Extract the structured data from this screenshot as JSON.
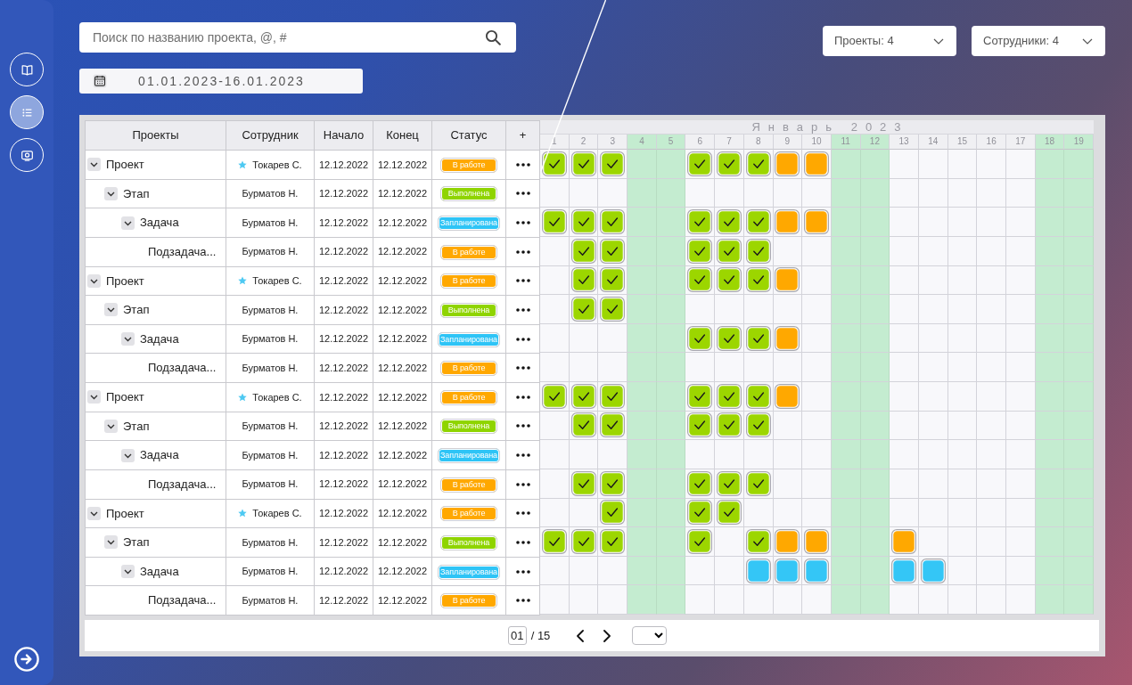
{
  "sidebar": {
    "items": [
      {
        "selected": false
      },
      {
        "selected": true
      },
      {
        "selected": false
      }
    ]
  },
  "search": {
    "placeholder": "Поиск по названию проекта, @, #"
  },
  "date_range": {
    "value": "01.01.2023-16.01.2023"
  },
  "filters": [
    {
      "label": "Проекты: 4"
    },
    {
      "label": "Сотрудники: 4"
    }
  ],
  "table": {
    "columns": [
      "Проекты",
      "Сотрудник",
      "Начало",
      "Конец",
      "Статус",
      "+"
    ],
    "rows": [
      {
        "name": "Проект",
        "expanded": true,
        "starred": true,
        "employee": "Токарев С.",
        "start": "12.12.2022",
        "end": "12.12.2022",
        "status": {
          "label": "В работе",
          "color": "#ffa800"
        },
        "timeline": [
          {
            "kind": "done"
          },
          {
            "kind": "done"
          },
          {
            "kind": "done"
          },
          {
            "kind": "empty"
          },
          {
            "kind": "empty"
          },
          {
            "kind": "done"
          },
          {
            "kind": "done"
          },
          {
            "kind": "done"
          },
          {
            "kind": "in_progress"
          },
          {
            "kind": "in_progress"
          },
          {
            "kind": "empty"
          },
          {
            "kind": "empty"
          },
          {
            "kind": "empty"
          },
          {
            "kind": "empty"
          },
          {
            "kind": "empty"
          },
          {
            "kind": "empty"
          },
          {
            "kind": "empty"
          },
          {
            "kind": "empty"
          },
          {
            "kind": "empty"
          }
        ],
        "children": [
          {
            "name": "Этап",
            "expanded": true,
            "starred": false,
            "employee": "Бурматов Н.",
            "start": "12.12.2022",
            "end": "12.12.2022",
            "status": {
              "label": "Выполнена",
              "color": "#8fd400"
            },
            "timeline": [
              {
                "kind": "empty"
              },
              {
                "kind": "empty"
              },
              {
                "kind": "empty"
              },
              {
                "kind": "empty"
              },
              {
                "kind": "empty"
              },
              {
                "kind": "empty"
              },
              {
                "kind": "empty"
              },
              {
                "kind": "empty"
              },
              {
                "kind": "empty"
              },
              {
                "kind": "empty"
              },
              {
                "kind": "empty"
              },
              {
                "kind": "empty"
              },
              {
                "kind": "empty"
              },
              {
                "kind": "empty"
              },
              {
                "kind": "empty"
              },
              {
                "kind": "empty"
              },
              {
                "kind": "empty"
              },
              {
                "kind": "empty"
              },
              {
                "kind": "empty"
              }
            ],
            "children": [
              {
                "name": "Задача",
                "expanded": true,
                "starred": false,
                "employee": "Бурматов Н.",
                "start": "12.12.2022",
                "end": "12.12.2022",
                "status": {
                  "label": "Запланирована",
                  "color": "#2ec4f6"
                },
                "timeline": [
                  {
                    "kind": "done"
                  },
                  {
                    "kind": "done"
                  },
                  {
                    "kind": "done"
                  },
                  {
                    "kind": "empty"
                  },
                  {
                    "kind": "empty"
                  },
                  {
                    "kind": "done"
                  },
                  {
                    "kind": "done"
                  },
                  {
                    "kind": "done"
                  },
                  {
                    "kind": "in_progress"
                  },
                  {
                    "kind": "in_progress"
                  },
                  {
                    "kind": "empty"
                  },
                  {
                    "kind": "empty"
                  },
                  {
                    "kind": "empty"
                  },
                  {
                    "kind": "empty"
                  },
                  {
                    "kind": "empty"
                  },
                  {
                    "kind": "empty"
                  },
                  {
                    "kind": "empty"
                  },
                  {
                    "kind": "empty"
                  },
                  {
                    "kind": "empty"
                  }
                ],
                "children": [
                  {
                    "name": "Подзадача...",
                    "starred": false,
                    "employee": "Бурматов Н.",
                    "start": "12.12.2022",
                    "end": "12.12.2022",
                    "status": {
                      "label": "В работе",
                      "color": "#ffa800"
                    },
                    "timeline": [
                      {
                        "kind": "empty"
                      },
                      {
                        "kind": "done"
                      },
                      {
                        "kind": "done"
                      },
                      {
                        "kind": "empty"
                      },
                      {
                        "kind": "empty"
                      },
                      {
                        "kind": "done"
                      },
                      {
                        "kind": "done"
                      },
                      {
                        "kind": "done"
                      },
                      {
                        "kind": "empty"
                      },
                      {
                        "kind": "empty"
                      },
                      {
                        "kind": "empty"
                      },
                      {
                        "kind": "empty"
                      },
                      {
                        "kind": "empty"
                      },
                      {
                        "kind": "empty"
                      },
                      {
                        "kind": "empty"
                      },
                      {
                        "kind": "empty"
                      },
                      {
                        "kind": "empty"
                      },
                      {
                        "kind": "empty"
                      },
                      {
                        "kind": "empty"
                      }
                    ]
                  }
                ]
              }
            ]
          }
        ]
      },
      {
        "name": "Проект",
        "expanded": true,
        "starred": true,
        "employee": "Токарев С.",
        "start": "12.12.2022",
        "end": "12.12.2022",
        "status": {
          "label": "В работе",
          "color": "#ffa800"
        },
        "timeline": [
          {
            "kind": "empty"
          },
          {
            "kind": "done"
          },
          {
            "kind": "done"
          },
          {
            "kind": "empty"
          },
          {
            "kind": "empty"
          },
          {
            "kind": "done"
          },
          {
            "kind": "done"
          },
          {
            "kind": "done"
          },
          {
            "kind": "in_progress"
          },
          {
            "kind": "empty"
          },
          {
            "kind": "empty"
          },
          {
            "kind": "empty"
          },
          {
            "kind": "empty"
          },
          {
            "kind": "empty"
          },
          {
            "kind": "empty"
          },
          {
            "kind": "empty"
          },
          {
            "kind": "empty"
          },
          {
            "kind": "empty"
          },
          {
            "kind": "empty"
          }
        ],
        "children": [
          {
            "name": "Этап",
            "expanded": true,
            "starred": false,
            "employee": "Бурматов Н.",
            "start": "12.12.2022",
            "end": "12.12.2022",
            "status": {
              "label": "Выполнена",
              "color": "#8fd400"
            },
            "timeline": [
              {
                "kind": "empty"
              },
              {
                "kind": "done"
              },
              {
                "kind": "done"
              },
              {
                "kind": "empty"
              },
              {
                "kind": "empty"
              },
              {
                "kind": "empty"
              },
              {
                "kind": "empty"
              },
              {
                "kind": "empty"
              },
              {
                "kind": "empty"
              },
              {
                "kind": "empty"
              },
              {
                "kind": "empty"
              },
              {
                "kind": "empty"
              },
              {
                "kind": "empty"
              },
              {
                "kind": "empty"
              },
              {
                "kind": "empty"
              },
              {
                "kind": "empty"
              },
              {
                "kind": "empty"
              },
              {
                "kind": "empty"
              },
              {
                "kind": "empty"
              }
            ],
            "children": [
              {
                "name": "Задача",
                "expanded": true,
                "starred": false,
                "employee": "Бурматов Н.",
                "start": "12.12.2022",
                "end": "12.12.2022",
                "status": {
                  "label": "Запланирована",
                  "color": "#2ec4f6"
                },
                "timeline": [
                  {
                    "kind": "empty"
                  },
                  {
                    "kind": "empty"
                  },
                  {
                    "kind": "empty"
                  },
                  {
                    "kind": "empty"
                  },
                  {
                    "kind": "empty"
                  },
                  {
                    "kind": "done"
                  },
                  {
                    "kind": "done"
                  },
                  {
                    "kind": "done"
                  },
                  {
                    "kind": "in_progress"
                  },
                  {
                    "kind": "empty"
                  },
                  {
                    "kind": "empty"
                  },
                  {
                    "kind": "empty"
                  },
                  {
                    "kind": "empty"
                  },
                  {
                    "kind": "empty"
                  },
                  {
                    "kind": "empty"
                  },
                  {
                    "kind": "empty"
                  },
                  {
                    "kind": "empty"
                  },
                  {
                    "kind": "empty"
                  },
                  {
                    "kind": "empty"
                  }
                ],
                "children": [
                  {
                    "name": "Подзадача...",
                    "starred": false,
                    "employee": "Бурматов Н.",
                    "start": "12.12.2022",
                    "end": "12.12.2022",
                    "status": {
                      "label": "В работе",
                      "color": "#ffa800"
                    },
                    "timeline": [
                      {
                        "kind": "empty"
                      },
                      {
                        "kind": "empty"
                      },
                      {
                        "kind": "empty"
                      },
                      {
                        "kind": "empty"
                      },
                      {
                        "kind": "empty"
                      },
                      {
                        "kind": "empty"
                      },
                      {
                        "kind": "empty"
                      },
                      {
                        "kind": "empty"
                      },
                      {
                        "kind": "empty"
                      },
                      {
                        "kind": "empty"
                      },
                      {
                        "kind": "empty"
                      },
                      {
                        "kind": "empty"
                      },
                      {
                        "kind": "empty"
                      },
                      {
                        "kind": "empty"
                      },
                      {
                        "kind": "empty"
                      },
                      {
                        "kind": "empty"
                      },
                      {
                        "kind": "empty"
                      },
                      {
                        "kind": "empty"
                      },
                      {
                        "kind": "empty"
                      }
                    ]
                  }
                ]
              }
            ]
          }
        ]
      },
      {
        "name": "Проект",
        "expanded": true,
        "starred": true,
        "employee": "Токарев С.",
        "start": "12.12.2022",
        "end": "12.12.2022",
        "status": {
          "label": "В работе",
          "color": "#ffa800"
        },
        "timeline": [
          {
            "kind": "done"
          },
          {
            "kind": "done"
          },
          {
            "kind": "done"
          },
          {
            "kind": "empty"
          },
          {
            "kind": "empty"
          },
          {
            "kind": "done"
          },
          {
            "kind": "done"
          },
          {
            "kind": "done"
          },
          {
            "kind": "in_progress"
          },
          {
            "kind": "empty"
          },
          {
            "kind": "empty"
          },
          {
            "kind": "empty"
          },
          {
            "kind": "empty"
          },
          {
            "kind": "empty"
          },
          {
            "kind": "empty"
          },
          {
            "kind": "empty"
          },
          {
            "kind": "empty"
          },
          {
            "kind": "empty"
          },
          {
            "kind": "empty"
          }
        ],
        "children": [
          {
            "name": "Этап",
            "expanded": true,
            "starred": false,
            "employee": "Бурматов Н.",
            "start": "12.12.2022",
            "end": "12.12.2022",
            "status": {
              "label": "Выполнена",
              "color": "#8fd400"
            },
            "timeline": [
              {
                "kind": "empty"
              },
              {
                "kind": "done"
              },
              {
                "kind": "done"
              },
              {
                "kind": "empty"
              },
              {
                "kind": "empty"
              },
              {
                "kind": "done"
              },
              {
                "kind": "done"
              },
              {
                "kind": "done"
              },
              {
                "kind": "empty"
              },
              {
                "kind": "empty"
              },
              {
                "kind": "empty"
              },
              {
                "kind": "empty"
              },
              {
                "kind": "empty"
              },
              {
                "kind": "empty"
              },
              {
                "kind": "empty"
              },
              {
                "kind": "empty"
              },
              {
                "kind": "empty"
              },
              {
                "kind": "empty"
              },
              {
                "kind": "empty"
              }
            ],
            "children": [
              {
                "name": "Задача",
                "expanded": true,
                "starred": false,
                "employee": "Бурматов Н.",
                "start": "12.12.2022",
                "end": "12.12.2022",
                "status": {
                  "label": "Запланирована",
                  "color": "#2ec4f6"
                },
                "timeline": [
                  {
                    "kind": "empty"
                  },
                  {
                    "kind": "empty"
                  },
                  {
                    "kind": "empty"
                  },
                  {
                    "kind": "empty"
                  },
                  {
                    "kind": "empty"
                  },
                  {
                    "kind": "empty"
                  },
                  {
                    "kind": "empty"
                  },
                  {
                    "kind": "empty"
                  },
                  {
                    "kind": "empty"
                  },
                  {
                    "kind": "empty"
                  },
                  {
                    "kind": "empty"
                  },
                  {
                    "kind": "empty"
                  },
                  {
                    "kind": "empty"
                  },
                  {
                    "kind": "empty"
                  },
                  {
                    "kind": "empty"
                  },
                  {
                    "kind": "empty"
                  },
                  {
                    "kind": "empty"
                  },
                  {
                    "kind": "empty"
                  },
                  {
                    "kind": "empty"
                  }
                ],
                "children": [
                  {
                    "name": "Подзадача...",
                    "starred": false,
                    "employee": "Бурматов Н.",
                    "start": "12.12.2022",
                    "end": "12.12.2022",
                    "status": {
                      "label": "В работе",
                      "color": "#ffa800"
                    },
                    "timeline": [
                      {
                        "kind": "empty"
                      },
                      {
                        "kind": "done"
                      },
                      {
                        "kind": "done"
                      },
                      {
                        "kind": "empty"
                      },
                      {
                        "kind": "empty"
                      },
                      {
                        "kind": "done"
                      },
                      {
                        "kind": "done"
                      },
                      {
                        "kind": "done"
                      },
                      {
                        "kind": "empty"
                      },
                      {
                        "kind": "empty"
                      },
                      {
                        "kind": "empty"
                      },
                      {
                        "kind": "empty"
                      },
                      {
                        "kind": "empty"
                      },
                      {
                        "kind": "empty"
                      },
                      {
                        "kind": "empty"
                      },
                      {
                        "kind": "empty"
                      },
                      {
                        "kind": "empty"
                      },
                      {
                        "kind": "empty"
                      },
                      {
                        "kind": "empty"
                      }
                    ]
                  }
                ]
              }
            ]
          }
        ]
      },
      {
        "name": "Проект",
        "expanded": true,
        "starred": true,
        "employee": "Токарев С.",
        "start": "12.12.2022",
        "end": "12.12.2022",
        "status": {
          "label": "В работе",
          "color": "#ffa800"
        },
        "timeline": [
          {
            "kind": "empty"
          },
          {
            "kind": "empty"
          },
          {
            "kind": "done"
          },
          {
            "kind": "empty"
          },
          {
            "kind": "empty"
          },
          {
            "kind": "done"
          },
          {
            "kind": "done"
          },
          {
            "kind": "empty"
          },
          {
            "kind": "empty"
          },
          {
            "kind": "empty"
          },
          {
            "kind": "empty"
          },
          {
            "kind": "empty"
          },
          {
            "kind": "empty"
          },
          {
            "kind": "empty"
          },
          {
            "kind": "empty"
          },
          {
            "kind": "empty"
          },
          {
            "kind": "empty"
          },
          {
            "kind": "empty"
          },
          {
            "kind": "empty"
          }
        ],
        "children": [
          {
            "name": "Этап",
            "expanded": true,
            "starred": false,
            "employee": "Бурматов Н.",
            "start": "12.12.2022",
            "end": "12.12.2022",
            "status": {
              "label": "Выполнена",
              "color": "#8fd400"
            },
            "timeline": [
              {
                "kind": "done"
              },
              {
                "kind": "done"
              },
              {
                "kind": "done"
              },
              {
                "kind": "empty"
              },
              {
                "kind": "empty"
              },
              {
                "kind": "done"
              },
              {
                "kind": "empty"
              },
              {
                "kind": "done"
              },
              {
                "kind": "in_progress"
              },
              {
                "kind": "in_progress"
              },
              {
                "kind": "empty"
              },
              {
                "kind": "empty"
              },
              {
                "kind": "in_progress"
              },
              {
                "kind": "empty"
              },
              {
                "kind": "empty"
              },
              {
                "kind": "empty"
              },
              {
                "kind": "empty"
              },
              {
                "kind": "empty"
              },
              {
                "kind": "empty"
              }
            ],
            "children": [
              {
                "name": "Задача",
                "expanded": true,
                "starred": false,
                "employee": "Бурматов Н.",
                "start": "12.12.2022",
                "end": "12.12.2022",
                "status": {
                  "label": "Запланирована",
                  "color": "#2ec4f6"
                },
                "timeline": [
                  {
                    "kind": "empty"
                  },
                  {
                    "kind": "empty"
                  },
                  {
                    "kind": "empty"
                  },
                  {
                    "kind": "empty"
                  },
                  {
                    "kind": "empty"
                  },
                  {
                    "kind": "empty"
                  },
                  {
                    "kind": "empty"
                  },
                  {
                    "kind": "planned"
                  },
                  {
                    "kind": "planned"
                  },
                  {
                    "kind": "planned"
                  },
                  {
                    "kind": "empty"
                  },
                  {
                    "kind": "empty"
                  },
                  {
                    "kind": "planned"
                  },
                  {
                    "kind": "planned"
                  },
                  {
                    "kind": "empty"
                  },
                  {
                    "kind": "empty"
                  },
                  {
                    "kind": "empty"
                  },
                  {
                    "kind": "empty"
                  },
                  {
                    "kind": "empty"
                  }
                ],
                "children": [
                  {
                    "name": "Подзадача...",
                    "starred": false,
                    "employee": "Бурматов Н.",
                    "start": "12.12.2022",
                    "end": "12.12.2022",
                    "status": {
                      "label": "В работе",
                      "color": "#ffa800"
                    },
                    "timeline": [
                      {
                        "kind": "empty"
                      },
                      {
                        "kind": "empty"
                      },
                      {
                        "kind": "empty"
                      },
                      {
                        "kind": "empty"
                      },
                      {
                        "kind": "empty"
                      },
                      {
                        "kind": "empty"
                      },
                      {
                        "kind": "empty"
                      },
                      {
                        "kind": "empty"
                      },
                      {
                        "kind": "empty"
                      },
                      {
                        "kind": "empty"
                      },
                      {
                        "kind": "empty"
                      },
                      {
                        "kind": "empty"
                      },
                      {
                        "kind": "empty"
                      },
                      {
                        "kind": "empty"
                      },
                      {
                        "kind": "empty"
                      },
                      {
                        "kind": "empty"
                      },
                      {
                        "kind": "empty"
                      },
                      {
                        "kind": "empty"
                      },
                      {
                        "kind": "empty"
                      }
                    ]
                  }
                ]
              }
            ]
          }
        ]
      }
    ]
  },
  "timeline": {
    "month": "Январь 2023",
    "days": [
      {
        "label": "1",
        "weekend": false
      },
      {
        "label": "2",
        "weekend": false
      },
      {
        "label": "3",
        "weekend": false
      },
      {
        "label": "4",
        "weekend": true
      },
      {
        "label": "5",
        "weekend": true
      },
      {
        "label": "6",
        "weekend": false
      },
      {
        "label": "7",
        "weekend": false
      },
      {
        "label": "8",
        "weekend": false
      },
      {
        "label": "9",
        "weekend": false
      },
      {
        "label": "10",
        "weekend": false
      },
      {
        "label": "11",
        "weekend": true
      },
      {
        "label": "12",
        "weekend": true
      },
      {
        "label": "13",
        "weekend": false
      },
      {
        "label": "14",
        "weekend": false
      },
      {
        "label": "15",
        "weekend": false
      },
      {
        "label": "16",
        "weekend": false
      },
      {
        "label": "17",
        "weekend": false
      },
      {
        "label": "18",
        "weekend": true
      },
      {
        "label": "19",
        "weekend": true
      }
    ]
  },
  "pagination": {
    "page": "01",
    "total": "/ 15"
  }
}
